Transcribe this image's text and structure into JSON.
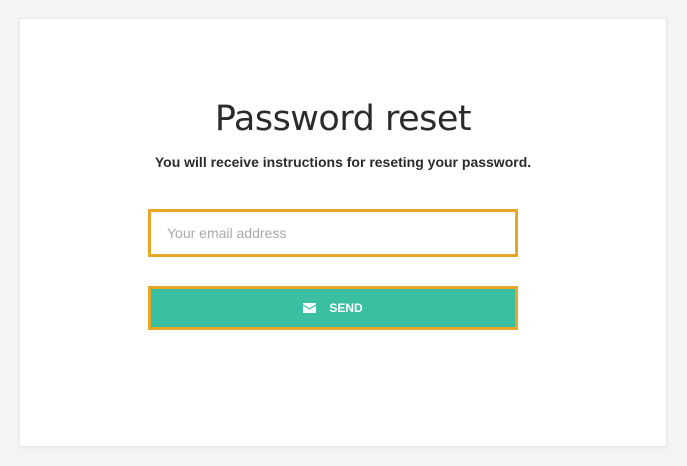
{
  "page": {
    "title": "Password reset",
    "subtitle": "You will receive instructions for reseting your password."
  },
  "form": {
    "email": {
      "placeholder": "Your email address",
      "value": ""
    },
    "send_button": {
      "label": "SEND",
      "icon": "envelope-icon"
    }
  },
  "colors": {
    "accent": "#3bbfa2",
    "highlight_border": "#e8a628",
    "title_text": "#2b2b2b",
    "placeholder_text": "#aaaaaa"
  }
}
